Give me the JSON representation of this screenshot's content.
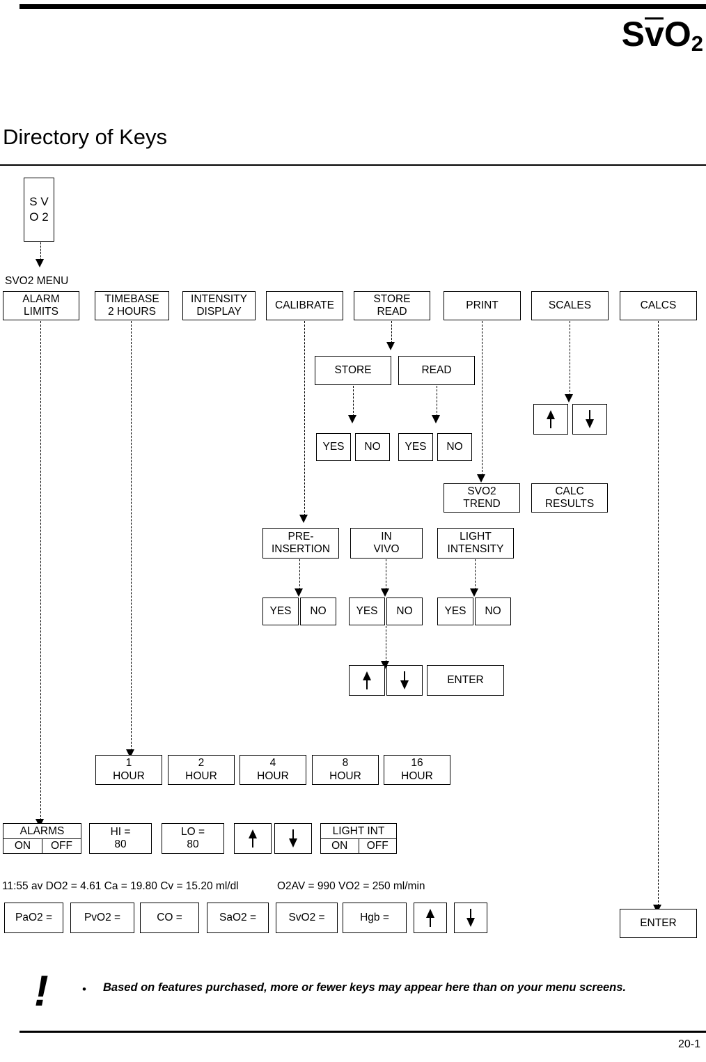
{
  "header": {
    "logo_s": "S",
    "logo_v": "v",
    "logo_o": "O",
    "logo_sub": "2",
    "title": "Directory of Keys"
  },
  "diagram": {
    "root_key": "S\nV\nO\n2",
    "menu_caption": "SVO2 MENU",
    "menu_row": [
      {
        "label": "ALARM\nLIMITS"
      },
      {
        "label": "TIMEBASE\n2 HOURS"
      },
      {
        "label": "INTENSITY\nDISPLAY"
      },
      {
        "label": "CALIBRATE"
      },
      {
        "label": "STORE\nREAD"
      },
      {
        "label": "PRINT"
      },
      {
        "label": "SCALES"
      },
      {
        "label": "CALCS"
      }
    ],
    "store_read_row": [
      {
        "label": "STORE"
      },
      {
        "label": "READ"
      }
    ],
    "store_yes_no": [
      {
        "label": "YES"
      },
      {
        "label": "NO"
      }
    ],
    "read_yes_no": [
      {
        "label": "YES"
      },
      {
        "label": "NO"
      }
    ],
    "print_row": [
      {
        "label": "SVO2\nTREND"
      },
      {
        "label": "CALC\nRESULTS"
      }
    ],
    "scales_arrows": [
      {
        "icon": "arrow-up-icon"
      },
      {
        "icon": "arrow-down-icon"
      }
    ],
    "calibrate_row": [
      {
        "label": "PRE-\nINSERTION"
      },
      {
        "label": "IN\nVIVO"
      },
      {
        "label": "LIGHT\nINTENSITY"
      }
    ],
    "calibrate_yes_no": [
      {
        "label": "YES"
      },
      {
        "label": "NO"
      },
      {
        "label": "YES"
      },
      {
        "label": "NO"
      },
      {
        "label": "YES"
      },
      {
        "label": "NO"
      }
    ],
    "invivo_controls": [
      {
        "icon": "arrow-up-icon",
        "label": ""
      },
      {
        "icon": "arrow-down-icon",
        "label": ""
      },
      {
        "icon": "",
        "label": "ENTER"
      }
    ],
    "timebase_row": [
      {
        "label": "1\nHOUR"
      },
      {
        "label": "2\nHOUR"
      },
      {
        "label": "4\nHOUR"
      },
      {
        "label": "8\nHOUR"
      },
      {
        "label": "16\nHOUR"
      }
    ],
    "alarms_box": {
      "head": "ALARMS",
      "on": "ON",
      "off": "OFF"
    },
    "alarm_row": [
      {
        "label": "HI =\n80"
      },
      {
        "label": "LO =\n80"
      }
    ],
    "alarm_arrows": [
      {
        "icon": "arrow-up-icon"
      },
      {
        "icon": "arrow-down-icon"
      }
    ],
    "light_int_box": {
      "head": "LIGHT INT",
      "on": "ON",
      "off": "OFF"
    },
    "calcs_readout_left": "11:55 av DO2 = 4.61 Ca = 19.80 Cv = 15.20 ml/dl",
    "calcs_readout_right": "O2AV = 990 VO2 = 250 ml/min",
    "calcs_row": [
      {
        "label": "PaO2 ="
      },
      {
        "label": "PvO2 ="
      },
      {
        "label": "CO ="
      },
      {
        "label": "SaO2 ="
      },
      {
        "label": "SvO2 ="
      },
      {
        "label": "Hgb ="
      }
    ],
    "calcs_arrows": [
      {
        "icon": "arrow-up-icon"
      },
      {
        "icon": "arrow-down-icon"
      }
    ],
    "calcs_enter": "ENTER"
  },
  "footer": {
    "bang": "!",
    "bullet": "•",
    "note": "Based on features purchased, more or fewer keys may appear here than on your menu screens.",
    "page_number": "20-1"
  }
}
